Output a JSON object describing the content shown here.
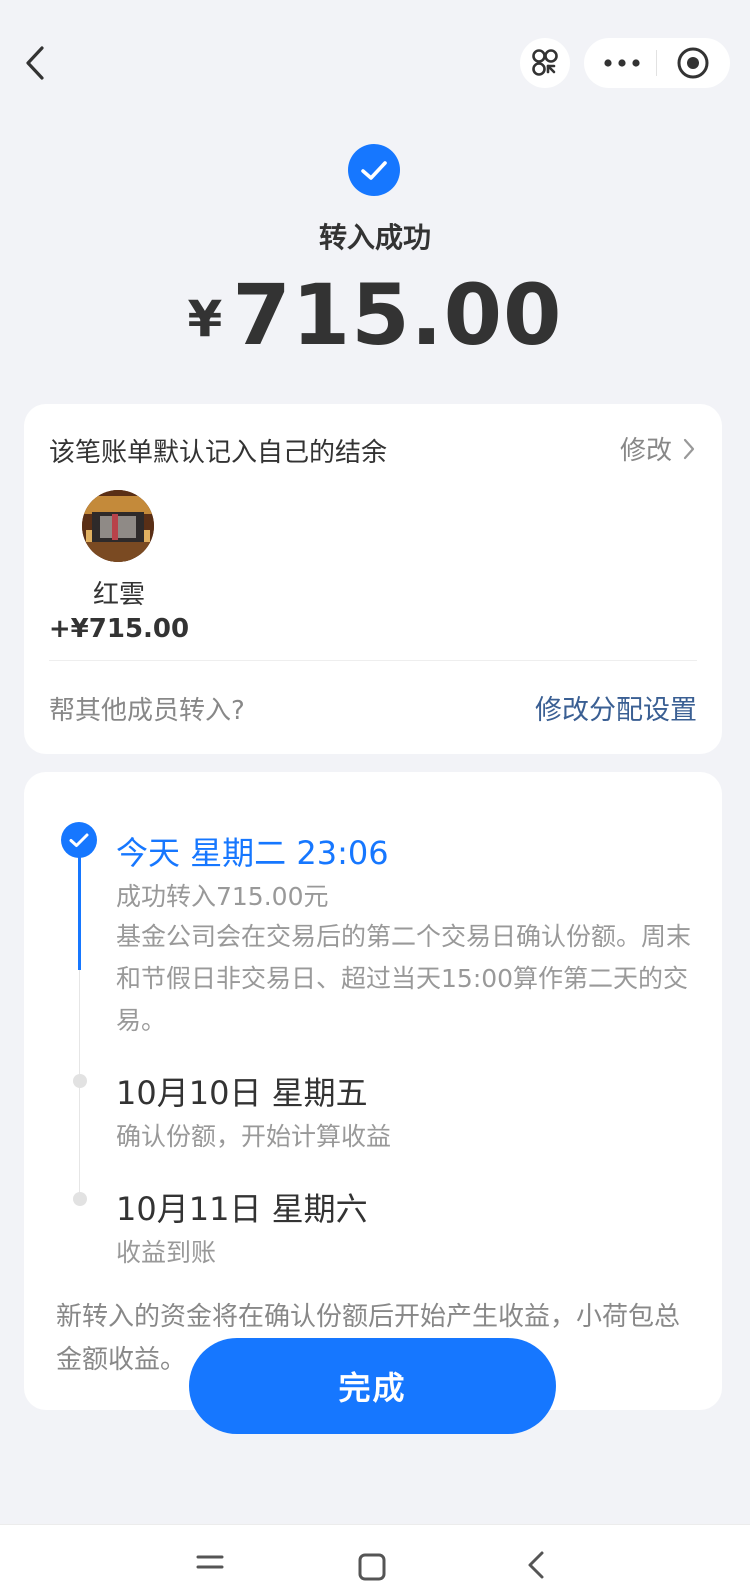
{
  "nav": {
    "back_icon": "chevron-left-icon",
    "scan_icon": "mini-program-icon",
    "more_icon": "more-dots-icon",
    "close_icon": "target-circle-icon"
  },
  "header": {
    "status_icon": "check-circle-icon",
    "title": "转入成功",
    "currency": "¥",
    "amount": "715.00"
  },
  "split_card": {
    "hint": "该笔账单默认记入自己的结余",
    "edit_label": "修改",
    "member": {
      "name": "红雲",
      "amount": "+¥715.00"
    },
    "other_prompt": "帮其他成员转入?",
    "modify_allocation": "修改分配设置"
  },
  "timeline": {
    "steps": [
      {
        "heading": "今天 星期二 23:06",
        "line1": "成功转入715.00元",
        "line2": "基金公司会在交易后的第二个交易日确认份额。周末和节假日非交易日、超过当天15:00算作第二天的交易。"
      },
      {
        "heading": "10月10日 星期五",
        "line1": "确认份额，开始计算收益"
      },
      {
        "heading": "10月11日 星期六",
        "line1": "收益到账"
      }
    ],
    "footnote": "新转入的资金将在确认份额后开始产生收益，小荷包总金额收益。"
  },
  "done_label": "完成",
  "colors": {
    "accent": "#1677ff",
    "link": "#3a5f93",
    "background": "#f2f3f7"
  }
}
